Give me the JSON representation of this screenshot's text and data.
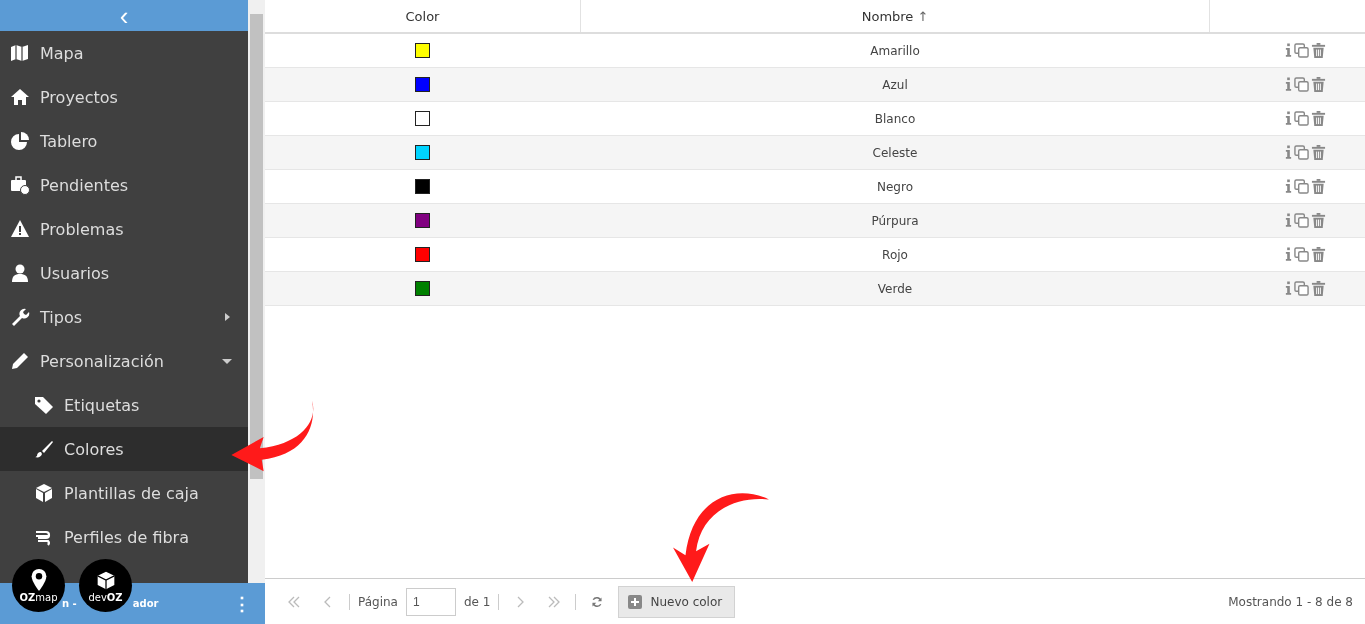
{
  "sidebar": {
    "collapse_icon": "‹",
    "items": [
      {
        "label": "Mapa",
        "selected": false
      },
      {
        "label": "Proyectos",
        "selected": false
      },
      {
        "label": "Tablero",
        "selected": false
      },
      {
        "label": "Pendientes",
        "selected": false
      },
      {
        "label": "Problemas",
        "selected": false
      },
      {
        "label": "Usuarios",
        "selected": false
      },
      {
        "label": "Tipos",
        "selected": false,
        "expanded": false
      },
      {
        "label": "Personalización",
        "selected": false,
        "expanded": true,
        "children": [
          {
            "label": "Etiquetas",
            "selected": false
          },
          {
            "label": "Colores",
            "selected": true
          },
          {
            "label": "Plantillas de caja",
            "selected": false
          },
          {
            "label": "Perfiles de fibra",
            "selected": false
          }
        ]
      }
    ],
    "footer": {
      "text_before": "n -",
      "text_after": "ador",
      "menu_icon": "⋮"
    },
    "badges": [
      {
        "brand": "OZ",
        "suffix": "map"
      },
      {
        "brand": "OZ",
        "prefix": "dev"
      }
    ]
  },
  "table": {
    "columns": [
      "Color",
      "Nombre"
    ],
    "sort_mark": "↑",
    "rows": [
      {
        "color": "#ffff00",
        "name": "Amarillo"
      },
      {
        "color": "#0000ff",
        "name": "Azul"
      },
      {
        "color": "#ffffff",
        "name": "Blanco"
      },
      {
        "color": "#00d4ff",
        "name": "Celeste"
      },
      {
        "color": "#000000",
        "name": "Negro"
      },
      {
        "color": "#800080",
        "name": "Púrpura"
      },
      {
        "color": "#ff0000",
        "name": "Rojo"
      },
      {
        "color": "#008000",
        "name": "Verde"
      }
    ]
  },
  "pager": {
    "page_label": "Página",
    "page": "1",
    "of": "de 1",
    "new_button": "Nuevo color",
    "summary": "Mostrando 1 - 8 de 8"
  }
}
